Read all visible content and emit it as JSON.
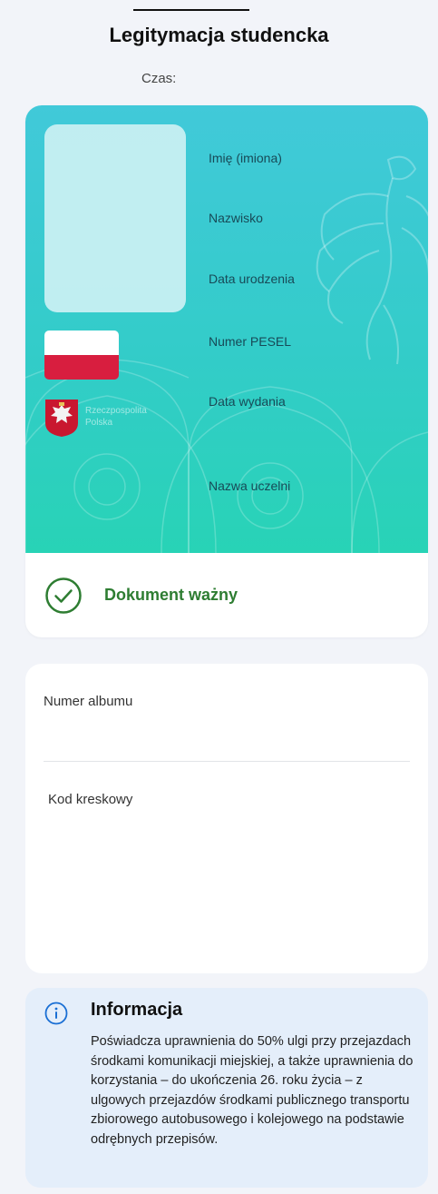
{
  "header": {
    "title": "Legitymacja studencka",
    "time_label": "Czas:"
  },
  "id_card": {
    "fields": [
      "Imię (imiona)",
      "Nazwisko",
      "Data urodzenia",
      "Numer PESEL",
      "Data wydania",
      "Nazwa uczelni"
    ],
    "country_line1": "Rzeczpospolita",
    "country_line2": "Polska",
    "status": "Dokument ważny",
    "colors": {
      "gradient_top": "#41c9d9",
      "gradient_bottom": "#28d3b6",
      "flag_red": "#d81e3f",
      "status_green": "#2e7d32"
    },
    "icons": [
      "eagle-watermark-icon",
      "coat-of-arms-icon",
      "check-circle-icon"
    ]
  },
  "album_card": {
    "album_label": "Numer albumu",
    "barcode_label": "Kod kreskowy"
  },
  "info_card": {
    "icon": "info-circle-icon",
    "title": "Informacja",
    "body": "Poświadcza uprawnienia do 50% ulgi przy przejazdach środkami komunikacji miejskiej, a także uprawnienia do korzystania – do ukończenia 26. roku życia – z ulgowych przejazdów środkami publicznego transportu zbiorowego autobusowego i kolejowego na podstawie odrębnych przepisów.",
    "accent": "#1a6fd4"
  }
}
